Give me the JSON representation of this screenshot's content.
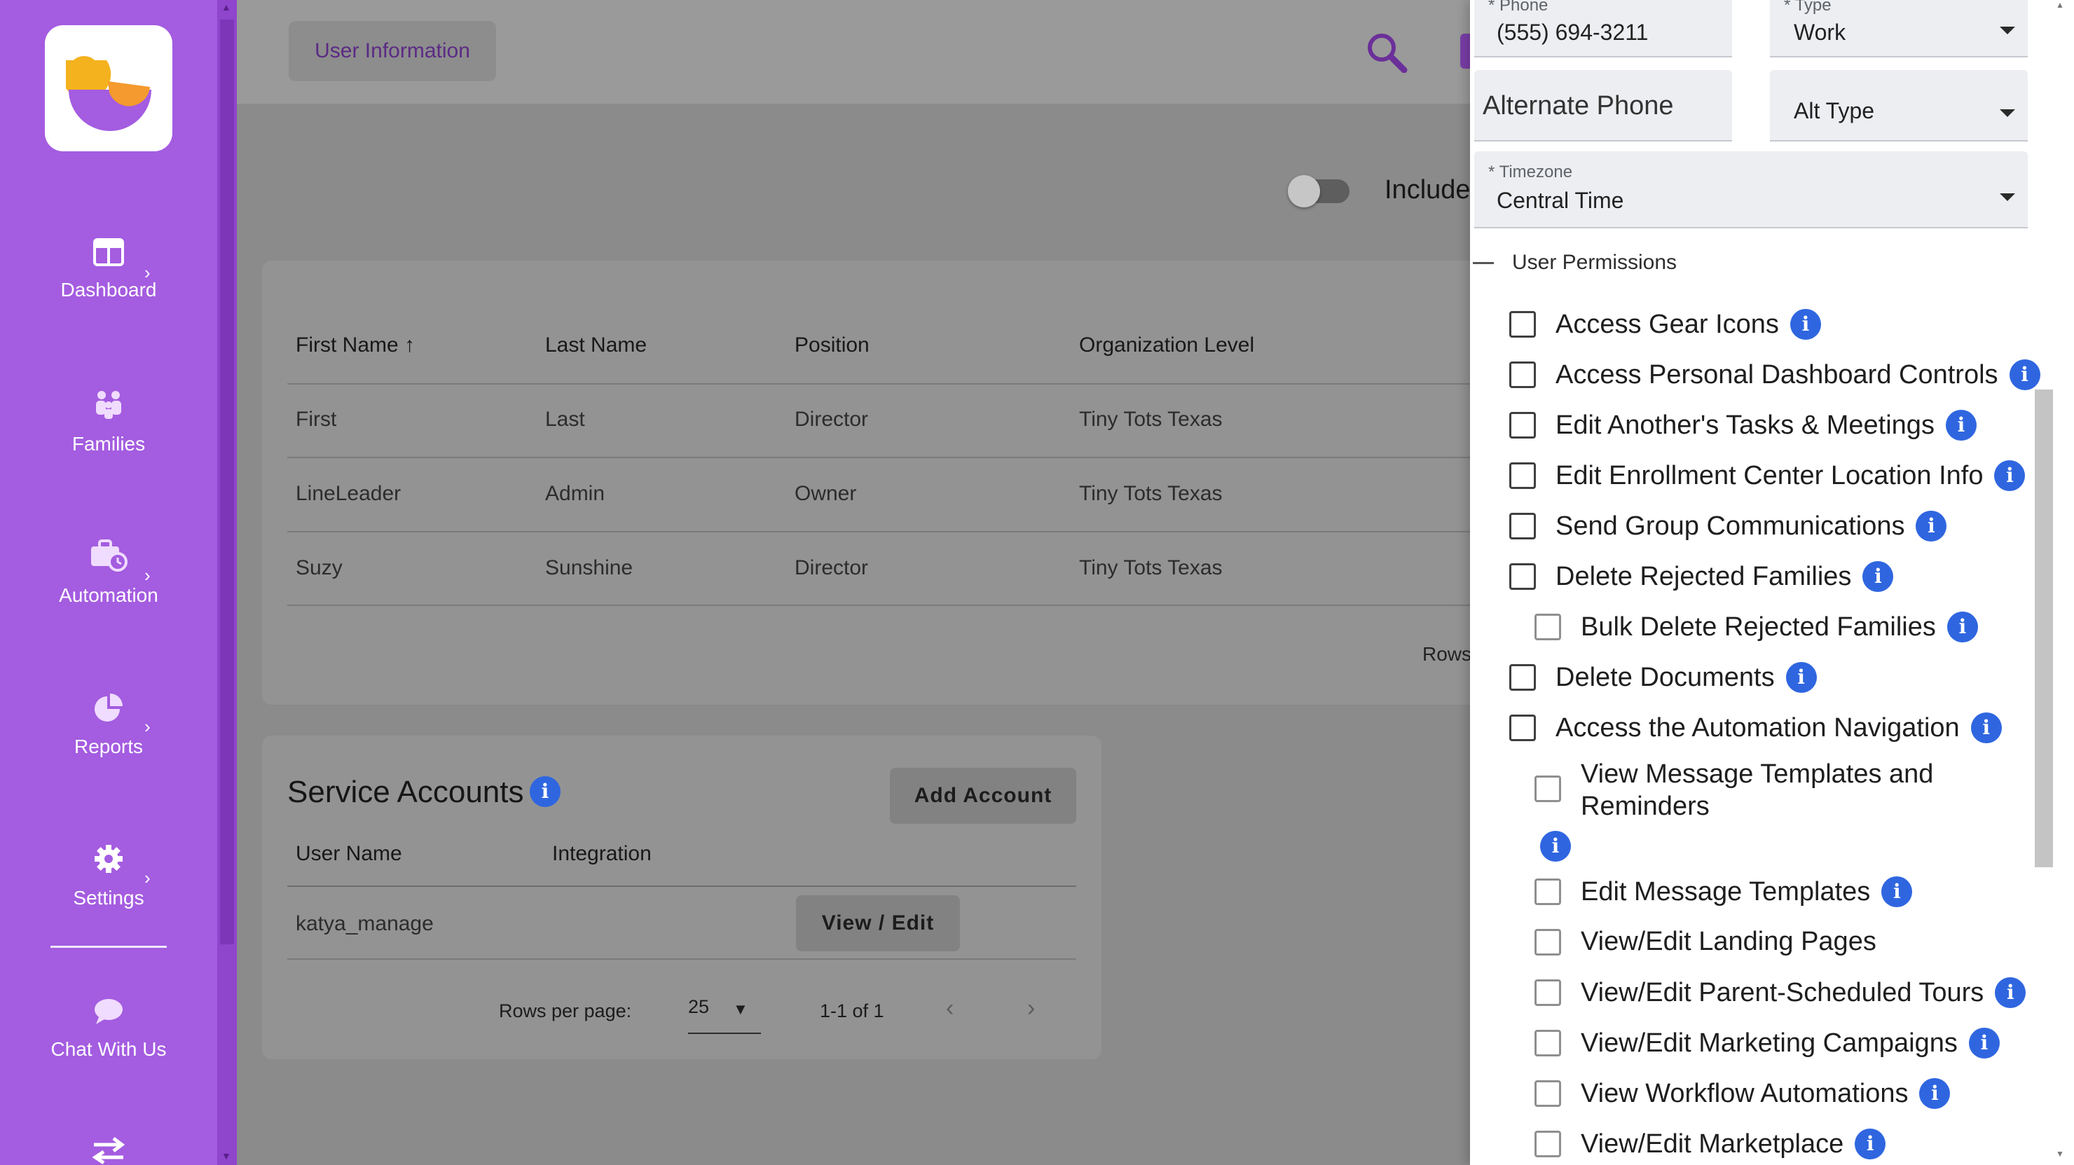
{
  "sidebar": {
    "items": [
      {
        "label": "Dashboard",
        "icon": "dashboard-icon"
      },
      {
        "label": "Families",
        "icon": "families-icon"
      },
      {
        "label": "Automation",
        "icon": "automation-icon"
      },
      {
        "label": "Reports",
        "icon": "reports-icon"
      },
      {
        "label": "Settings",
        "icon": "gear-icon"
      },
      {
        "label": "Chat With Us",
        "icon": "chat-icon"
      }
    ],
    "accent": "#a45ce0"
  },
  "header": {
    "breadcrumb": "User Information",
    "include_label": "Include"
  },
  "users_table": {
    "columns": [
      "First Name",
      "Last Name",
      "Position",
      "Organization Level"
    ],
    "sort_indicator": "↑",
    "rows": [
      [
        "First",
        "Last",
        "Director",
        "Tiny Tots Texas"
      ],
      [
        "LineLeader",
        "Admin",
        "Owner",
        "Tiny Tots Texas"
      ],
      [
        "Suzy",
        "Sunshine",
        "Director",
        "Tiny Tots Texas"
      ]
    ],
    "rows_partial": "Rows"
  },
  "service_accounts": {
    "title": "Service Accounts",
    "add_button": "Add Account",
    "columns": [
      "User Name",
      "Integration"
    ],
    "rows": [
      {
        "user_name": "katya_manage",
        "integration": "",
        "action": "View / Edit"
      }
    ],
    "pagination": {
      "rows_per_page_label": "Rows per page:",
      "rows_per_page": "25",
      "range": "1-1 of 1"
    }
  },
  "drawer": {
    "phone": {
      "label": "* Phone",
      "value": "(555) 694-3211"
    },
    "type": {
      "label": "* Type",
      "value": "Work"
    },
    "alt_phone": {
      "placeholder": "Alternate Phone"
    },
    "alt_type": {
      "placeholder": "Alt Type"
    },
    "timezone": {
      "label": "* Timezone",
      "value": "Central Time"
    },
    "permissions_title": "User Permissions",
    "permissions": [
      {
        "label": "Access Gear Icons"
      },
      {
        "label": "Access Personal Dashboard Controls"
      },
      {
        "label": "Edit Another's Tasks & Meetings"
      },
      {
        "label": "Edit Enrollment Center Location Info"
      },
      {
        "label": "Send Group Communications"
      },
      {
        "label": "Delete Rejected Families"
      },
      {
        "label": "Bulk Delete Rejected Families"
      },
      {
        "label": "Delete Documents"
      },
      {
        "label": "Access the Automation Navigation"
      },
      {
        "label_line1": "View Message Templates and",
        "label_line2": "Reminders"
      },
      {
        "label": "Edit Message Templates"
      },
      {
        "label": "View/Edit Landing Pages"
      },
      {
        "label": "View/Edit Parent-Scheduled Tours"
      },
      {
        "label": "View/Edit Marketing Campaigns"
      },
      {
        "label": "View Workflow Automations"
      },
      {
        "label": "View/Edit Marketplace"
      }
    ],
    "info_color": "#2f66e0"
  }
}
